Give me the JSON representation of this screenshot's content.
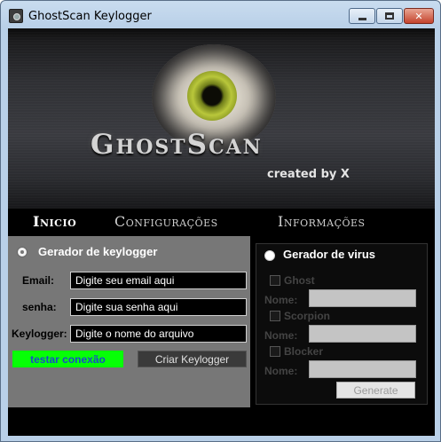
{
  "window": {
    "title": "GhostScan Keylogger",
    "minimize_label": "minimize",
    "maximize_label": "maximize",
    "close_label": "✕"
  },
  "banner": {
    "logo_text": "GhostScan",
    "subtitle": "created by X"
  },
  "nav": {
    "items": [
      {
        "label": "Inicio",
        "active": true
      },
      {
        "label": "Configurações",
        "active": false
      },
      {
        "label": "Informações",
        "active": false
      }
    ]
  },
  "keylogger_panel": {
    "title": "Gerador de keylogger",
    "email_label": "Email:",
    "email_placeholder": "Digite seu email aqui",
    "senha_label": "senha:",
    "senha_placeholder": "Digite sua senha aqui",
    "keylogger_label": "Keylogger:",
    "keylogger_placeholder": "Digite o nome do arquivo",
    "test_button": "testar conexão",
    "create_button": "Criar Keylogger"
  },
  "virus_panel": {
    "title": "Gerador de virus",
    "options": [
      {
        "label": "Ghost",
        "checked": false,
        "nome_label": "Nome:"
      },
      {
        "label": "Scorpion",
        "checked": false,
        "nome_label": "Nome:"
      },
      {
        "label": "Blocker",
        "checked": false,
        "nome_label": "Nome:"
      }
    ],
    "generate_button": "Generate"
  },
  "colors": {
    "test_button_bg": "#06ff06",
    "test_button_text": "#1a4cc7",
    "panel_gray": "#777777"
  },
  "icons": {
    "app_icon": "ghostscan-app-icon",
    "eye_graphic": "eye-icon"
  }
}
